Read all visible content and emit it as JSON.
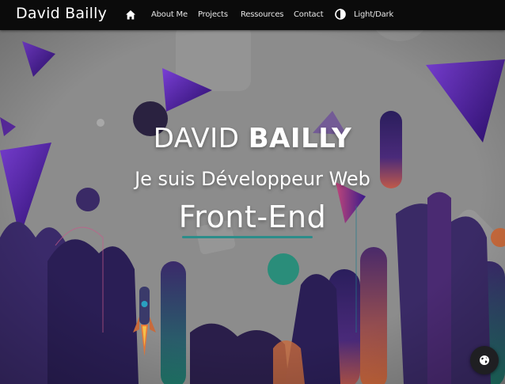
{
  "navbar": {
    "brand": "David Bailly",
    "home_icon": "home-icon",
    "links": [
      "About Me",
      "Projects",
      "Ressources",
      "Contact"
    ],
    "theme_icon": "half-circle-contrast-icon",
    "theme_label": "Light/Dark"
  },
  "hero": {
    "name_first": "DAVID",
    "name_last": "BAILLY",
    "subtitle": "Je suis Développeur Web",
    "role": "Front-End"
  },
  "floating_button": {
    "icon": "globe-icon"
  },
  "colors": {
    "navbar_bg": "#0b0b0b",
    "hero_bg": "#8c8c8c",
    "accent_teal": "#2c8d8a",
    "purple": "#5b1fa0",
    "orange": "#c86a3c"
  }
}
